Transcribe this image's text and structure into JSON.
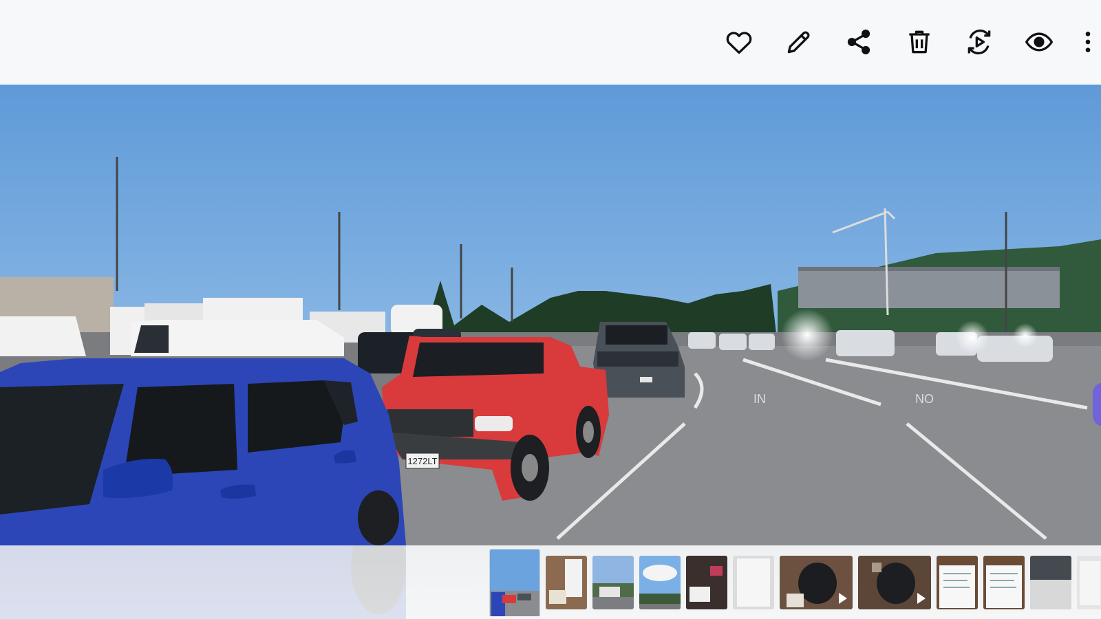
{
  "toolbar": {
    "actions": [
      {
        "name": "favorite",
        "icon": "heart-icon"
      },
      {
        "name": "edit",
        "icon": "pencil-icon"
      },
      {
        "name": "share",
        "icon": "share-icon"
      },
      {
        "name": "delete",
        "icon": "trash-icon"
      },
      {
        "name": "remaster",
        "icon": "play-sync-icon"
      },
      {
        "name": "view",
        "icon": "eye-icon"
      },
      {
        "name": "more",
        "icon": "more-vertical-icon"
      }
    ]
  },
  "photo": {
    "license_plate": "1272LT"
  },
  "filmstrip": {
    "selected_index": 0,
    "thumbnails": [
      {
        "kind": "photo",
        "scene": "parking-lot"
      },
      {
        "kind": "photo",
        "scene": "car-interior"
      },
      {
        "kind": "photo",
        "scene": "roadside"
      },
      {
        "kind": "photo",
        "scene": "sky"
      },
      {
        "kind": "photo",
        "scene": "clutter"
      },
      {
        "kind": "photo",
        "scene": "paper"
      },
      {
        "kind": "video",
        "scene": "dog"
      },
      {
        "kind": "video",
        "scene": "dog"
      },
      {
        "kind": "photo",
        "scene": "note"
      },
      {
        "kind": "photo",
        "scene": "note"
      },
      {
        "kind": "photo",
        "scene": "bed"
      },
      {
        "kind": "photo",
        "scene": "paper"
      }
    ]
  },
  "colors": {
    "toolbar_bg": "#f7f8fa",
    "icon": "#111111",
    "sky": "#6aa3dd",
    "accent": "#6c5ce7"
  }
}
